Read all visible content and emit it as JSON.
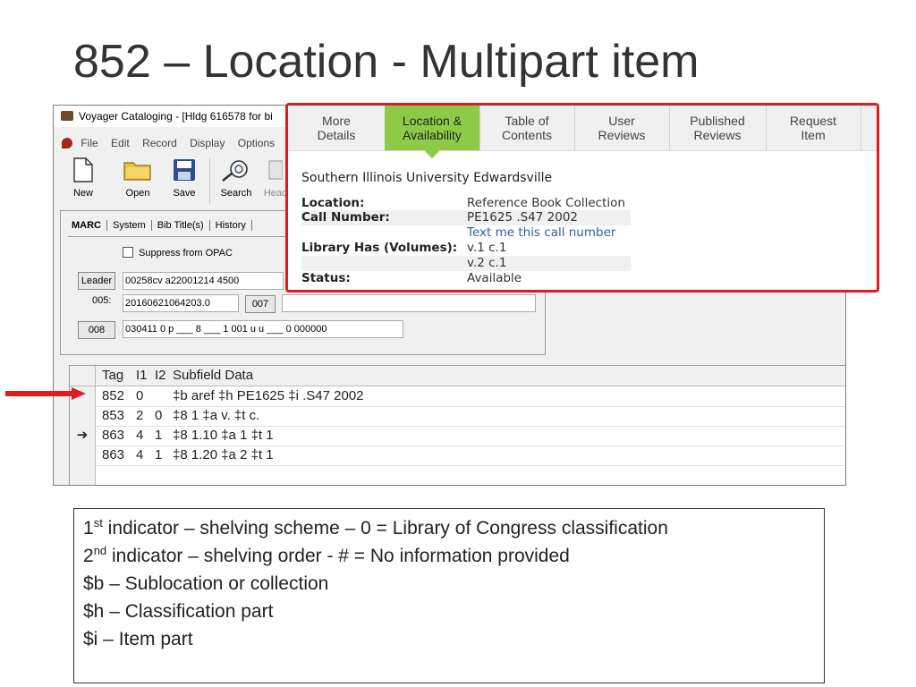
{
  "slide": {
    "title": "852 – Location - Multipart item"
  },
  "voyager": {
    "window_title": "Voyager Cataloging - [Hldg 616578 for bi",
    "menu": [
      "File",
      "Edit",
      "Record",
      "Display",
      "Options"
    ],
    "toolbar": [
      "New",
      "Open",
      "Save",
      "Search",
      "Head"
    ],
    "tabs": [
      "MARC",
      "System",
      "Bib Title(s)",
      "History"
    ],
    "suppress_label": "Suppress from OPAC",
    "leader_button": "Leader",
    "leader_value": "00258cv  a22001214  4500",
    "f005_label": "005:",
    "f005_value": "20160621064203.0",
    "f007_button": "007",
    "f008_button": "008",
    "f008_value": "030411  0  p  ___  8  ___  1  001  u  u  ___  0  000000",
    "grid_headers": {
      "tag": "Tag",
      "i1": "I1",
      "i2": "I2",
      "subfields": "Subfield Data"
    },
    "grid_rows": [
      {
        "marker": "",
        "tag": "852",
        "i1": "0",
        "i2": "",
        "subfields": "‡b aref ‡h PE1625 ‡i .S47 2002"
      },
      {
        "marker": "",
        "tag": "853",
        "i1": "2",
        "i2": "0",
        "subfields": "‡8 1 ‡a v. ‡t c."
      },
      {
        "marker": "➔",
        "tag": "863",
        "i1": "4",
        "i2": "1",
        "subfields": "‡8 1.10 ‡a 1 ‡t 1"
      },
      {
        "marker": "",
        "tag": "863",
        "i1": "4",
        "i2": "1",
        "subfields": "‡8 1.20 ‡a 2 ‡t 1"
      }
    ]
  },
  "opac": {
    "tabs": [
      {
        "line1": "More",
        "line2": "Details"
      },
      {
        "line1": "Location &",
        "line2": "Availability"
      },
      {
        "line1": "Table of",
        "line2": "Contents"
      },
      {
        "line1": "User",
        "line2": "Reviews"
      },
      {
        "line1": "Published",
        "line2": "Reviews"
      },
      {
        "line1": "Request",
        "line2": "Item"
      }
    ],
    "library": "Southern Illinois University Edwardsville",
    "location_label": "Location:",
    "location_value": "Reference Book Collection",
    "call_label": "Call Number:",
    "call_value": "PE1625 .S47 2002",
    "text_me": "Text me this call number",
    "has_label": "Library Has (Volumes):",
    "vol1": "v.1 c.1",
    "vol2": "v.2 c.1",
    "status_label": "Status:",
    "status_value": "Available",
    "accent": "#8dcb47",
    "frame_color": "#e01b1b"
  },
  "notes": {
    "ind1_ord": "1",
    "ind1_sup": "st",
    "ind1_text": " indicator – shelving scheme – 0 = Library of Congress classification",
    "ind2_ord": "2",
    "ind2_sup": "nd",
    "ind2_text": " indicator – shelving order - # = No information provided",
    "b": "$b – Sublocation or collection",
    "h": "$h – Classification part",
    "i": "$i – Item part"
  }
}
